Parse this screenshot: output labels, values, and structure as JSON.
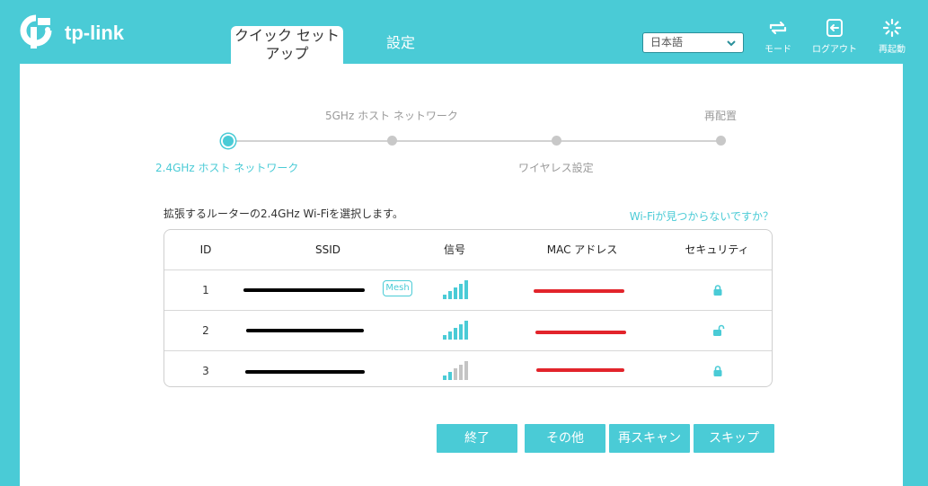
{
  "header": {
    "logo_text": "tp-link",
    "tabs": [
      {
        "label": "クイック セット\nアップ",
        "line1": "クイック セット",
        "line2": "アップ",
        "active": true
      },
      {
        "label": "設定",
        "active": false
      }
    ],
    "language": {
      "selected": "日本語"
    },
    "buttons": [
      {
        "label": "モード",
        "icon": "mode-icon"
      },
      {
        "label": "ログアウト",
        "icon": "logout-icon"
      },
      {
        "label": "再起動",
        "icon": "reboot-icon"
      }
    ]
  },
  "steps": [
    {
      "label": "2.4GHz ホスト ネットワーク",
      "state": "current"
    },
    {
      "label": "5GHz ホスト ネットワーク",
      "state": "pending"
    },
    {
      "label": "ワイヤレス設定",
      "state": "pending"
    },
    {
      "label": "再配置",
      "state": "pending"
    }
  ],
  "instruction": "拡張するルーターの2.4GHz Wi-Fiを選択します。",
  "help_link": "Wi-Fiが見つからないですか？",
  "table": {
    "columns": [
      "ID",
      "SSID",
      "信号",
      "MAC アドレス",
      "セキュリティ"
    ],
    "rows": [
      {
        "id": "1",
        "ssid_redacted": true,
        "mesh_badge": "Mesh",
        "signal_bars": 4,
        "mac_redacted": true,
        "security": "locked"
      },
      {
        "id": "2",
        "ssid_redacted": true,
        "mesh_badge": "",
        "signal_bars": 4,
        "mac_redacted": true,
        "security": "unlocked"
      },
      {
        "id": "3",
        "ssid_redacted": true,
        "mesh_badge": "",
        "signal_bars": 2,
        "mac_redacted": true,
        "security": "locked"
      }
    ]
  },
  "buttons": {
    "finish": "終了",
    "other": "その他",
    "rescan": "再スキャン",
    "skip": "スキップ"
  },
  "colors": {
    "accent": "#4acbd6",
    "redaction_ssid": "#000000",
    "redaction_mac": "#e2242b",
    "inactive": "#c8c8c8"
  }
}
